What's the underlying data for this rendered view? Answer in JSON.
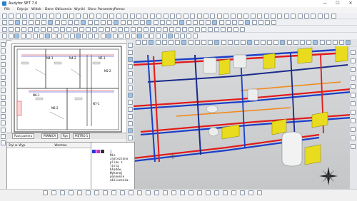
{
  "app": {
    "title": "Audytor SET 7.0"
  },
  "window": {
    "minimize": "—",
    "maximize": "☐",
    "close": "✕"
  },
  "menu": [
    "Plik",
    "Edycja",
    "Widok",
    "Dane",
    "Obliczenia",
    "Wyniki",
    "Okno",
    "Parametry",
    "Pomoc"
  ],
  "plan_labels": [
    "N4-1",
    "N4-2",
    "N5-1",
    "N5-2",
    "N6-1",
    "N6-2",
    "N7-1"
  ],
  "drawing_tabs": [
    {
      "label": "Rzut parteru",
      "active": true
    },
    {
      "label": "PIWNICA",
      "active": false
    },
    {
      "label": "Rys",
      "active": false
    },
    {
      "label": "PIĘTRO 1",
      "active": false
    }
  ],
  "panel_left": {
    "col1": "Styl w. Wyp.",
    "col2": "Warstwa"
  },
  "messages": {
    "header": "1",
    "lines": [
      "Nie",
      "znaleziono",
      "pliku z",
      "listą",
      "błędów.",
      "Wykonaj",
      "ponownie",
      "obliczenia."
    ]
  },
  "colors": {
    "pipe_red": "#e21b1b",
    "pipe_blue": "#1c3fc8",
    "pipe_darkblue": "#1a2a8a",
    "pipe_orange": "#f28a1a",
    "radiator_yellow": "#e9dc1e",
    "viewport_bg": "#d5d7d9",
    "accent_toolbar": "#9cc3ea"
  },
  "icons": [
    "compass-rose-icon",
    "settings-icon",
    "zoom-icon",
    "rotate-icon"
  ]
}
